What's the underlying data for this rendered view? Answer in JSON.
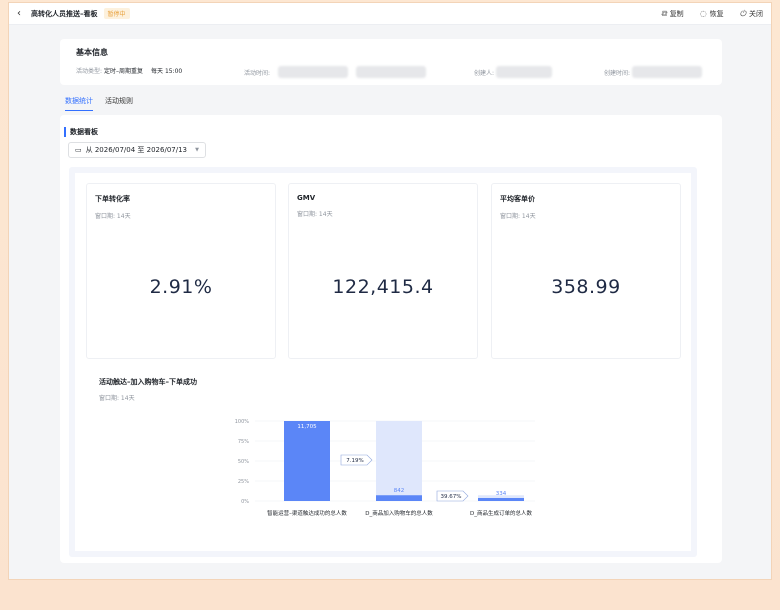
{
  "topbar": {
    "back_icon": "chevron-left-icon",
    "title": "高转化人员推送–看板",
    "status": "暂停中",
    "actions": [
      {
        "icon": "copy-icon",
        "glyph": "⧉",
        "label": "复制"
      },
      {
        "icon": "restore-icon",
        "glyph": "◌",
        "label": "恢复"
      },
      {
        "icon": "power-icon",
        "glyph": "⏻",
        "label": "关闭"
      }
    ]
  },
  "basic_info": {
    "title": "基本信息",
    "type_label": "活动类型:",
    "type_value": "定时–周期重复",
    "schedule": "每天 15:00",
    "time_label": "活动时间:",
    "creator_label": "创建人:",
    "created_label": "创建时间:"
  },
  "tabs": [
    {
      "label": "数据统计",
      "active": true
    },
    {
      "label": "活动规则",
      "active": false
    }
  ],
  "board": {
    "title": "数据看板",
    "date_icon": "calendar-icon",
    "date_range": "从 2026/07/04 至 2026/07/13",
    "metrics": [
      {
        "name": "下单转化率",
        "window": "窗口期: 14天",
        "value": "2.91%"
      },
      {
        "name": "GMV",
        "window": "窗口期: 14天",
        "value": "122,415.4"
      },
      {
        "name": "平均客单价",
        "window": "窗口期: 14天",
        "value": "358.99"
      }
    ],
    "funnel": {
      "title": "活动触达–加入购物车–下单成功",
      "window": "窗口期: 14天"
    }
  },
  "chart_data": {
    "type": "bar",
    "categories": [
      "智能运营–渠道触达成功的总人数",
      "D_商品加入购物车的总人数",
      "D_商品生成订单的总人数"
    ],
    "values": [
      11705,
      842,
      334
    ],
    "value_labels": [
      "11,705",
      "842",
      "334"
    ],
    "conversion_rates": [
      "7.19%",
      "39.67%"
    ],
    "yticks": [
      "100%",
      "75%",
      "50%",
      "25%",
      "0%"
    ],
    "ylim": [
      0,
      100
    ],
    "colors": {
      "bar": "#5b86f7",
      "bar_light": "#dfe7fc",
      "grid": "#edeff3"
    }
  }
}
